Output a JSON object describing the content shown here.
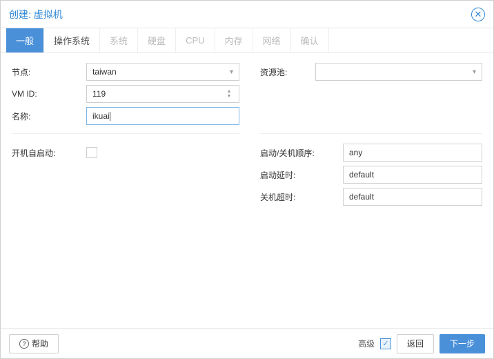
{
  "dialog": {
    "title": "创建: 虚拟机"
  },
  "tabs": {
    "general": "一般",
    "os": "操作系统",
    "system": "系统",
    "disk": "硬盘",
    "cpu": "CPU",
    "memory": "内存",
    "network": "网络",
    "confirm": "确认"
  },
  "form": {
    "node_label": "节点:",
    "node_value": "taiwan",
    "vmid_label": "VM ID:",
    "vmid_value": "119",
    "name_label": "名称:",
    "name_value": "ikuai",
    "pool_label": "资源池:",
    "pool_value": "",
    "autostart_label": "开机自启动:",
    "order_label": "启动/关机顺序:",
    "order_value": "any",
    "startup_delay_label": "启动延时:",
    "startup_delay_value": "default",
    "shutdown_timeout_label": "关机超时:",
    "shutdown_timeout_value": "default"
  },
  "footer": {
    "help": "帮助",
    "advanced": "高级",
    "back": "返回",
    "next": "下一步"
  }
}
